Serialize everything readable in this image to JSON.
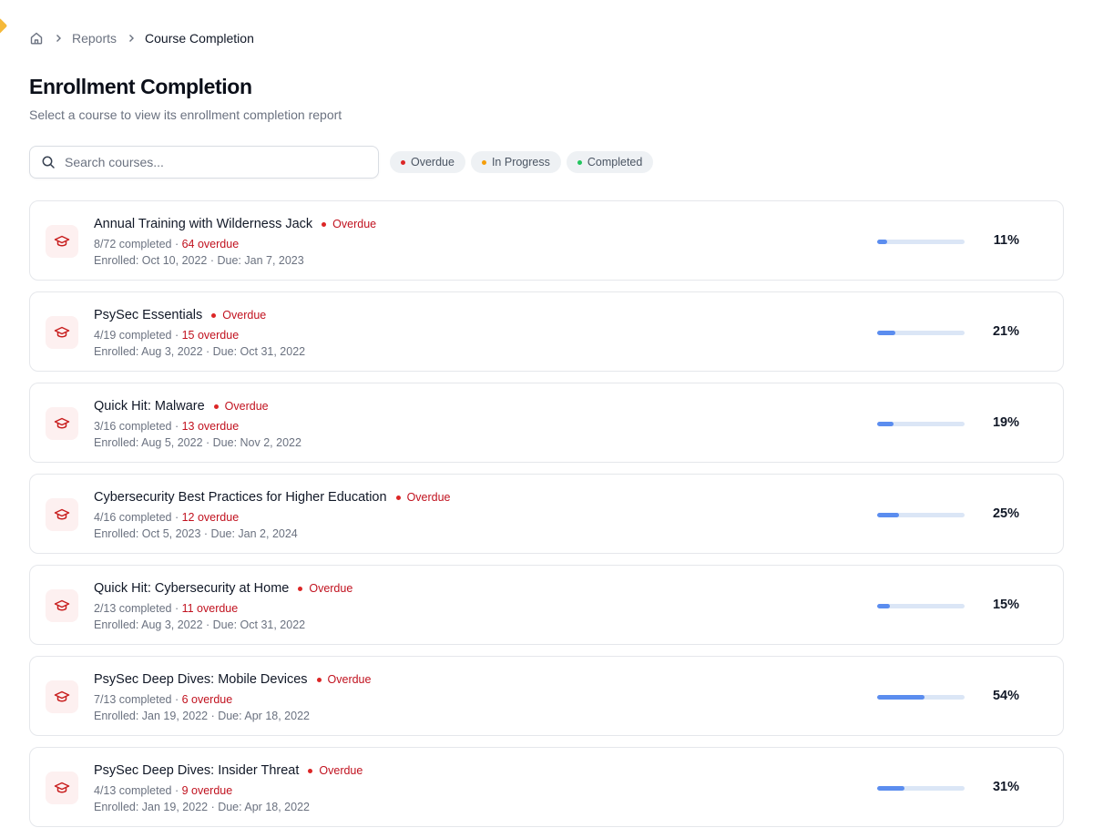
{
  "breadcrumb": {
    "items": [
      "Reports",
      "Course Completion"
    ]
  },
  "header": {
    "title": "Enrollment Completion",
    "subtitle": "Select a course to view its enrollment completion report"
  },
  "search": {
    "placeholder": "Search courses...",
    "value": ""
  },
  "filters": [
    {
      "label": "Overdue",
      "color": "#dc2626"
    },
    {
      "label": "In Progress",
      "color": "#f59e0b"
    },
    {
      "label": "Completed",
      "color": "#22c55e"
    }
  ],
  "courses": [
    {
      "title": "Annual Training with Wilderness Jack",
      "status": "Overdue",
      "completed": "8/72 completed",
      "overdue": "64 overdue",
      "enrolled": "Enrolled: Oct 10, 2022",
      "due": "Due: Jan 7, 2023",
      "progress": 11,
      "percent_label": "11%"
    },
    {
      "title": "PsySec Essentials",
      "status": "Overdue",
      "completed": "4/19 completed",
      "overdue": "15 overdue",
      "enrolled": "Enrolled: Aug 3, 2022",
      "due": "Due: Oct 31, 2022",
      "progress": 21,
      "percent_label": "21%"
    },
    {
      "title": "Quick Hit: Malware",
      "status": "Overdue",
      "completed": "3/16 completed",
      "overdue": "13 overdue",
      "enrolled": "Enrolled: Aug 5, 2022",
      "due": "Due: Nov 2, 2022",
      "progress": 19,
      "percent_label": "19%"
    },
    {
      "title": "Cybersecurity Best Practices for Higher Education",
      "status": "Overdue",
      "completed": "4/16 completed",
      "overdue": "12 overdue",
      "enrolled": "Enrolled: Oct 5, 2023",
      "due": "Due: Jan 2, 2024",
      "progress": 25,
      "percent_label": "25%"
    },
    {
      "title": "Quick Hit: Cybersecurity at Home",
      "status": "Overdue",
      "completed": "2/13 completed",
      "overdue": "11 overdue",
      "enrolled": "Enrolled: Aug 3, 2022",
      "due": "Due: Oct 31, 2022",
      "progress": 15,
      "percent_label": "15%"
    },
    {
      "title": "PsySec Deep Dives: Mobile Devices",
      "status": "Overdue",
      "completed": "7/13 completed",
      "overdue": "6 overdue",
      "enrolled": "Enrolled: Jan 19, 2022",
      "due": "Due: Apr 18, 2022",
      "progress": 54,
      "percent_label": "54%"
    },
    {
      "title": "PsySec Deep Dives: Insider Threat",
      "status": "Overdue",
      "completed": "4/13 completed",
      "overdue": "9 overdue",
      "enrolled": "Enrolled: Jan 19, 2022",
      "due": "Due: Apr 18, 2022",
      "progress": 31,
      "percent_label": "31%"
    }
  ],
  "colors": {
    "accent": "#5b8def",
    "track": "#dbe6f6",
    "overdue": "#dc2626",
    "icon_bg": "#fdf0f0"
  },
  "icons": {
    "home": "home-icon",
    "chevron": "chevron-right-icon",
    "search": "search-icon",
    "course": "graduation-cap-icon"
  }
}
